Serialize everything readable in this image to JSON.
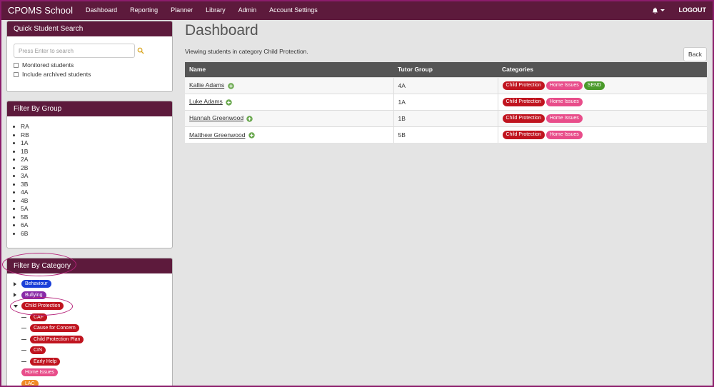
{
  "navbar": {
    "brand": "CPOMS School",
    "items": [
      "Dashboard",
      "Reporting",
      "Planner",
      "Library",
      "Admin",
      "Account Settings"
    ],
    "logout": "LOGOUT"
  },
  "quick_search": {
    "title": "Quick Student Search",
    "placeholder": "Press Enter to search",
    "monitored_label": "Monitored students",
    "archived_label": "Include archived students"
  },
  "filter_group": {
    "title": "Filter By Group",
    "groups": [
      "RA",
      "RB",
      "1A",
      "1B",
      "2A",
      "2B",
      "3A",
      "3B",
      "4A",
      "4B",
      "5A",
      "5B",
      "6A",
      "6B"
    ]
  },
  "filter_category": {
    "title": "Filter By Category",
    "items": [
      {
        "label": "Behaviour",
        "color": "#1a3fd8",
        "kind": "collapsed"
      },
      {
        "label": "Bullying",
        "color": "#8a2aa8",
        "kind": "collapsed"
      },
      {
        "label": "Child Protection",
        "color": "#c0141f",
        "kind": "expanded"
      },
      {
        "label": "CAF",
        "color": "#c0141f",
        "kind": "child"
      },
      {
        "label": "Cause for Concern",
        "color": "#c0141f",
        "kind": "child"
      },
      {
        "label": "Child Protection Plan",
        "color": "#c0141f",
        "kind": "child"
      },
      {
        "label": "CIN",
        "color": "#c0141f",
        "kind": "child"
      },
      {
        "label": "Early Help",
        "color": "#c0141f",
        "kind": "child"
      },
      {
        "label": "Home Issues",
        "color": "#e84d8a",
        "kind": "leaf"
      },
      {
        "label": "LAC",
        "color": "#f08a24",
        "kind": "leaf"
      }
    ]
  },
  "main": {
    "title": "Dashboard",
    "subtitle": "Viewing students in category Child Protection.",
    "back_label": "Back",
    "columns": [
      "Name",
      "Tutor Group",
      "Categories"
    ],
    "rows": [
      {
        "name": "Kallie Adams",
        "group": "4A",
        "categories": [
          "Child Protection",
          "Home Issues",
          "SEND"
        ]
      },
      {
        "name": "Luke Adams",
        "group": "1A",
        "categories": [
          "Child Protection",
          "Home Issues"
        ]
      },
      {
        "name": "Hannah Greenwood",
        "group": "1B",
        "categories": [
          "Child Protection",
          "Home Issues"
        ]
      },
      {
        "name": "Matthew Greenwood",
        "group": "5B",
        "categories": [
          "Child Protection",
          "Home Issues"
        ]
      }
    ]
  },
  "colors": {
    "brand": "#5d1a3c",
    "Child Protection": "#c0141f",
    "Home Issues": "#e84d8a",
    "SEND": "#4a9a2a",
    "annotation": "#b5237a"
  },
  "icons": [
    "bell-icon",
    "search-icon",
    "add-icon"
  ]
}
